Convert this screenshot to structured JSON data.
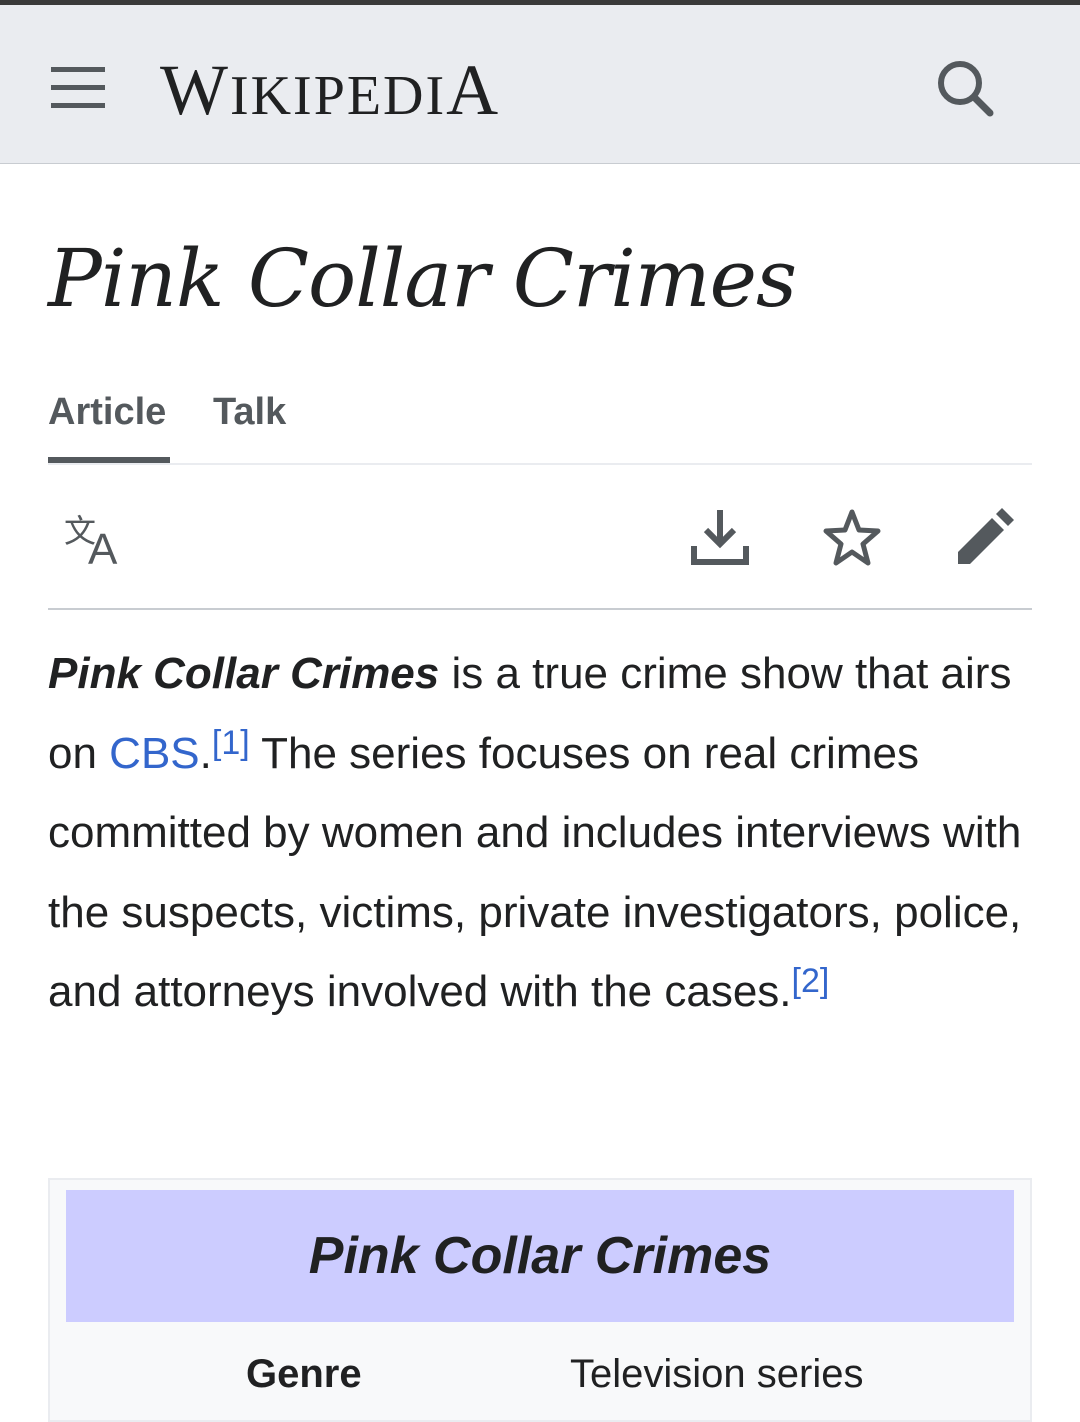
{
  "header": {
    "logo_text_first": "W",
    "logo_text_mid": "IKIPEDI",
    "logo_text_last": "A",
    "menu_icon": "hamburger-menu-icon",
    "search_icon": "search-icon"
  },
  "article": {
    "title": "Pink Collar Crimes",
    "tabs": [
      {
        "label": "Article",
        "active": true
      },
      {
        "label": "Talk",
        "active": false
      }
    ],
    "actions": [
      "language-icon",
      "download-icon",
      "star-icon",
      "edit-pencil-icon"
    ],
    "intro": {
      "bold_title": "Pink Collar Crimes",
      "text1": " is a true crime show that airs on ",
      "link_cbs": "CBS",
      "text2": ".",
      "ref1": "[1]",
      "text3": " The series focuses on real crimes committed by women and includes interviews with the suspects, victims, private investigators, police, and attorneys involved with the cases.",
      "ref2": "[2]"
    }
  },
  "infobox": {
    "title": "Pink Collar Crimes",
    "rows": [
      {
        "label": "Genre",
        "value": "Television series"
      }
    ]
  },
  "colors": {
    "header_bg": "#eaecf0",
    "link": "#3366cc",
    "infobox_title_bg": "#ccccff",
    "icon_gray": "#54595d"
  }
}
